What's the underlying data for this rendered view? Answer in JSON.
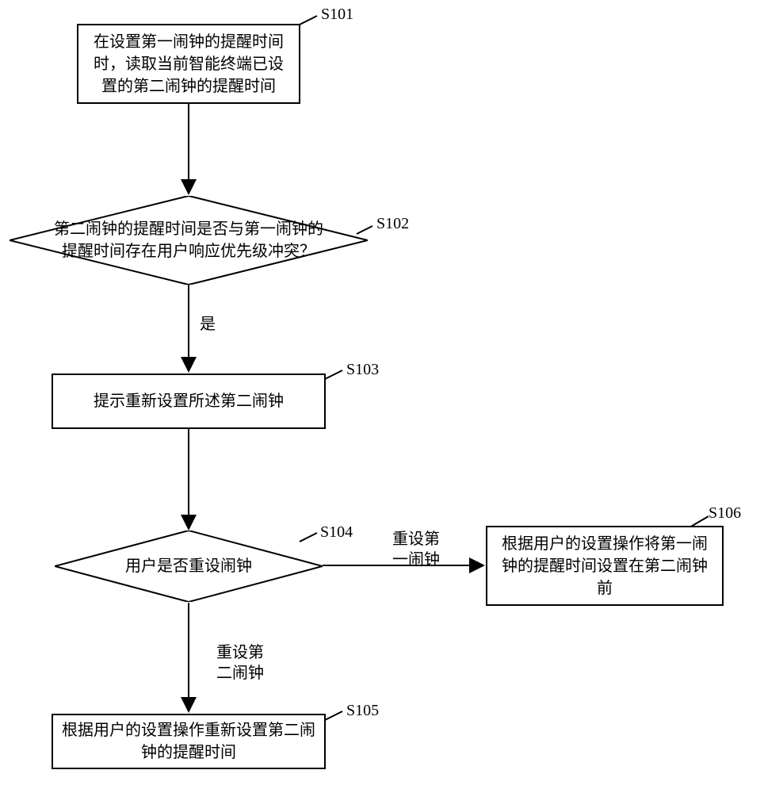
{
  "nodes": {
    "s101": {
      "id": "S101",
      "text": "在设置第一闹钟的提醒时间时，读取当前智能终端已设置的第二闹钟的提醒时间"
    },
    "s102": {
      "id": "S102",
      "text": "第二闹钟的提醒时间是否与第一闹钟的提醒时间存在用户响应优先级冲突？"
    },
    "s103": {
      "id": "S103",
      "text": "提示重新设置所述第二闹钟"
    },
    "s104": {
      "id": "S104",
      "text": "用户是否重设闹钟"
    },
    "s105": {
      "id": "S105",
      "text": "根据用户的设置操作重新设置第二闹钟的提醒时间"
    },
    "s106": {
      "id": "S106",
      "text": "根据用户的设置操作将第一闹钟的提醒时间设置在第二闹钟前"
    }
  },
  "edges": {
    "e1": "是",
    "e2_a": "重设第",
    "e2_b": "一闹钟",
    "e3_a": "重设第",
    "e3_b": "二闹钟"
  }
}
